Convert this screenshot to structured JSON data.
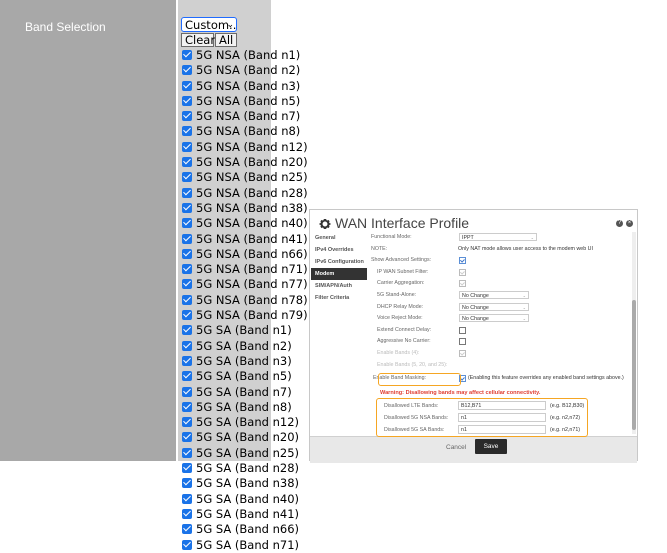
{
  "left": {
    "label": "Band Selection",
    "select_value": "Custom...",
    "clear_label": "Clear",
    "all_label": "All",
    "bands": [
      "5G NSA (Band n1)",
      "5G NSA (Band n2)",
      "5G NSA (Band n3)",
      "5G NSA (Band n5)",
      "5G NSA (Band n7)",
      "5G NSA (Band n8)",
      "5G NSA (Band n12)",
      "5G NSA (Band n20)",
      "5G NSA (Band n25)",
      "5G NSA (Band n28)",
      "5G NSA (Band n38)",
      "5G NSA (Band n40)",
      "5G NSA (Band n41)",
      "5G NSA (Band n66)",
      "5G NSA (Band n71)",
      "5G NSA (Band n77)",
      "5G NSA (Band n78)",
      "5G NSA (Band n79)",
      "5G SA (Band n1)",
      "5G SA (Band n2)",
      "5G SA (Band n3)",
      "5G SA (Band n5)",
      "5G SA (Band n7)",
      "5G SA (Band n8)",
      "5G SA (Band n12)",
      "5G SA (Band n20)",
      "5G SA (Band n25)",
      "5G SA (Band n28)",
      "5G SA (Band n38)",
      "5G SA (Band n40)",
      "5G SA (Band n41)",
      "5G SA (Band n66)",
      "5G SA (Band n71)"
    ]
  },
  "dialog": {
    "title": "WAN Interface Profile",
    "nav": [
      "General",
      "IPv4 Overrides",
      "IPv6 Configuration",
      "Modem",
      "SIM/APN/Auth",
      "Filter Criteria"
    ],
    "active_nav": "Modem",
    "functional_mode_label": "Functional Mode:",
    "functional_mode_value": "IPPT",
    "note_label": "NOTE:",
    "note_text": "Only NAT mode allows user access to the modem web UI",
    "show_advanced_label": "Show Advanced Settings:",
    "ip_wan_subnet_label": "IP WAN Subnet Filter:",
    "carrier_agg_label": "Carrier Aggregation:",
    "sa_label": "5G Stand-Alone:",
    "sa_value": "No Change",
    "dhcp_label": "DHCP Relay Mode:",
    "dhcp_value": "No Change",
    "voice_label": "Voice Reject Mode:",
    "voice_value": "No Change",
    "extend_label": "Extend Connect Delay:",
    "aggressive_label": "Aggressive No Carrier:",
    "enable_b3_label": "Enable Bands (4):",
    "enable_b5_label": "Enable Bands (5, 20, and 25):",
    "enable_masking_label": "Enable Band Masking:",
    "masking_note": "(Enabling this feature overrides any enabled band settings above.)",
    "warning": "Warning: Disallowing bands may affect cellular connectivity.",
    "lte_label": "Disallowed LTE Bands:",
    "lte_value": "B12,B71",
    "lte_example": "(e.g. B12,B30)",
    "nsa_label": "Disallowed 5G NSA Bands:",
    "nsa_value": "n1",
    "nsa_example": "(e.g. n2,n72)",
    "sa_bands_label": "Disallowed 5G SA Bands:",
    "sa_bands_value": "n1",
    "sa_bands_example": "(e.g. n2,n71)",
    "cancel_label": "Cancel",
    "save_label": "Save"
  }
}
